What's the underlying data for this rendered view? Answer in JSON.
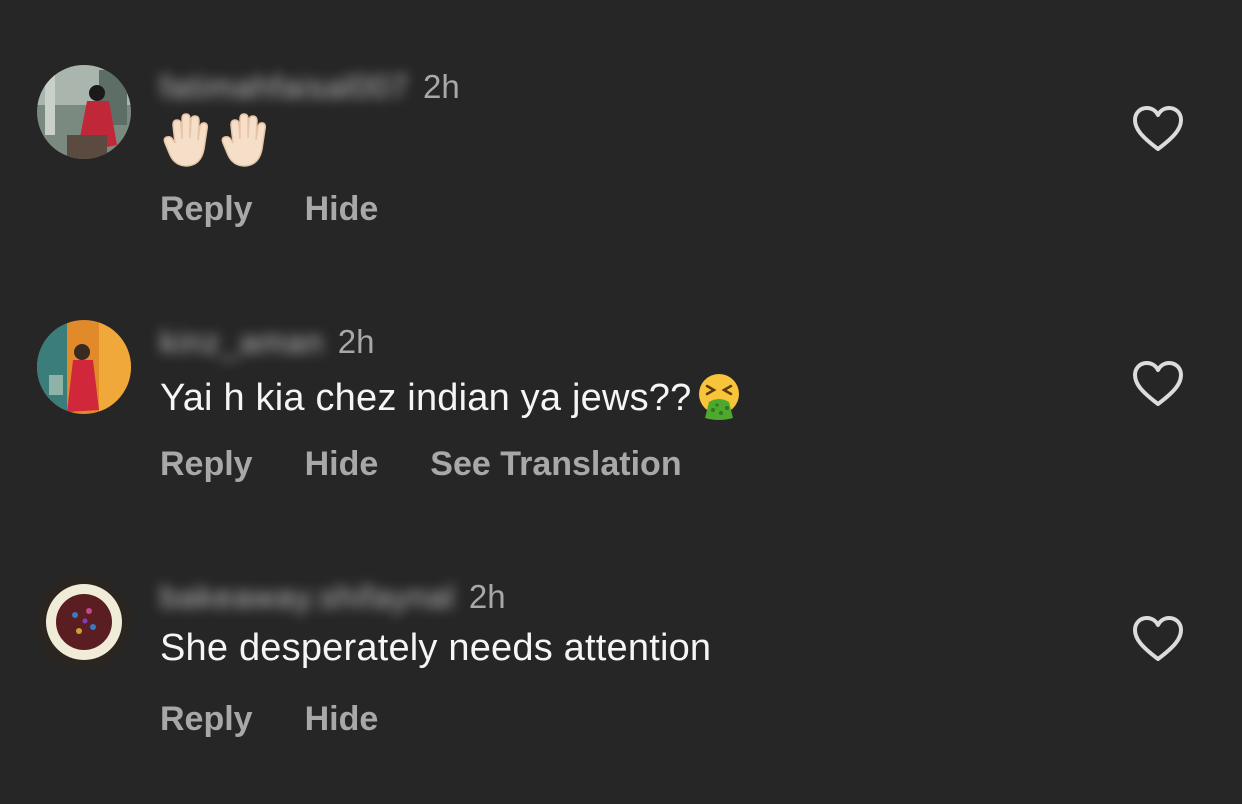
{
  "comments": [
    {
      "username": "fatimahfaisal007",
      "time": "2h",
      "text": "",
      "emoji": [
        "raised-hand-emoji",
        "raised-hand-emoji"
      ],
      "actions": [
        "Reply",
        "Hide"
      ]
    },
    {
      "username": "kinz_aman",
      "time": "2h",
      "text": "Yai h kia chez indian ya jews??",
      "emoji": [
        "vomiting-face-emoji"
      ],
      "actions": [
        "Reply",
        "Hide",
        "See Translation"
      ]
    },
    {
      "username": "bakeaway.shifaynal",
      "time": "2h",
      "text": "She desperately needs attention",
      "emoji": [],
      "actions": [
        "Reply",
        "Hide"
      ]
    }
  ],
  "colors": {
    "background": "#262626",
    "text_primary": "#f5f5f5",
    "text_secondary": "#a8a8a8"
  }
}
